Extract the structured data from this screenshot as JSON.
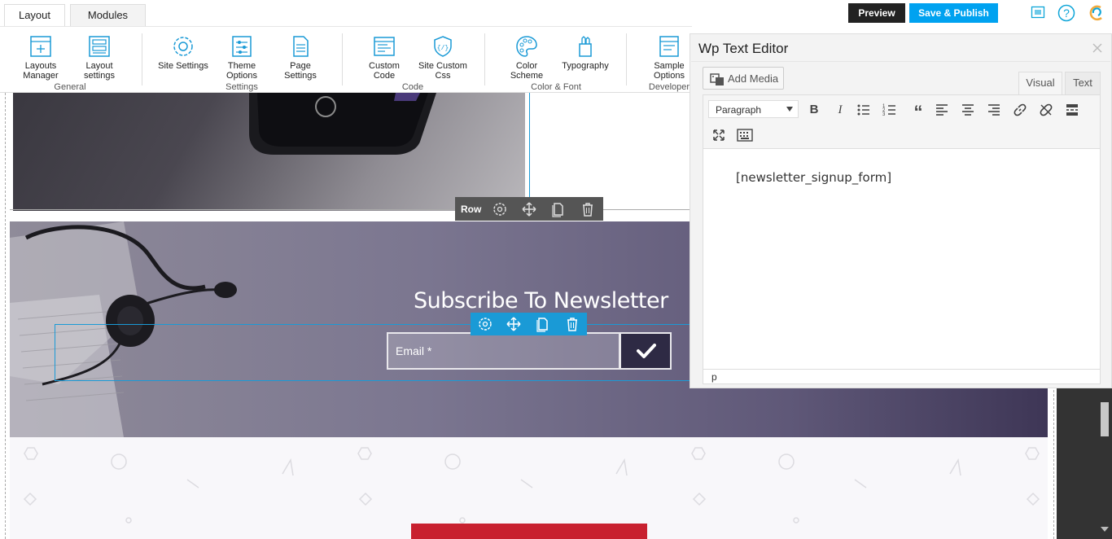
{
  "topbar": {
    "tabs": [
      {
        "label": "Layout",
        "active": true
      },
      {
        "label": "Modules",
        "active": false
      }
    ],
    "preview_label": "Preview",
    "publish_label": "Save & Publish",
    "icons": [
      "preview-frame-icon",
      "help-icon",
      "loader-logo-icon"
    ],
    "colors": {
      "preview_bg": "#222222",
      "publish_bg": "#00a2f0",
      "accent": "#0ea5d8"
    }
  },
  "ribbon": {
    "groups": [
      {
        "label": "General",
        "buttons": [
          {
            "label": "Layouts Manager",
            "icon": "layouts-manager-icon"
          },
          {
            "label": "Layout settings",
            "icon": "layout-settings-icon"
          }
        ]
      },
      {
        "label": "Settings",
        "buttons": [
          {
            "label": "Site Settings",
            "icon": "site-settings-icon"
          },
          {
            "label": "Theme Options",
            "icon": "theme-options-icon"
          },
          {
            "label": "Page Settings",
            "icon": "page-settings-icon"
          }
        ]
      },
      {
        "label": "Code",
        "buttons": [
          {
            "label": "Custom Code",
            "icon": "custom-code-icon"
          },
          {
            "label": "Site Custom Css",
            "icon": "site-css-icon"
          }
        ]
      },
      {
        "label": "Color & Font",
        "buttons": [
          {
            "label": "Color Scheme",
            "icon": "color-scheme-icon"
          },
          {
            "label": "Typography",
            "icon": "typography-icon"
          }
        ]
      },
      {
        "label": "Developer",
        "buttons": [
          {
            "label": "Sample Options",
            "icon": "sample-options-icon"
          }
        ]
      }
    ]
  },
  "canvas": {
    "row_toolbar": {
      "label": "Row",
      "icons": [
        "settings-icon",
        "move-icon",
        "duplicate-icon",
        "delete-icon"
      ]
    },
    "module_toolbar": {
      "icons": [
        "settings-icon",
        "move-icon",
        "duplicate-icon",
        "delete-icon"
      ]
    },
    "newsletter": {
      "heading": "Subscribe To Newsletter",
      "email_placeholder": "Email *",
      "submit_icon": "checkmark-icon"
    }
  },
  "editor": {
    "title": "Wp Text Editor",
    "add_media_label": "Add Media",
    "tabs": [
      {
        "label": "Visual",
        "active": true
      },
      {
        "label": "Text",
        "active": false
      }
    ],
    "format_select": "Paragraph",
    "toolbar_icons": [
      "bold-icon",
      "italic-icon",
      "bullet-list-icon",
      "numbered-list-icon",
      "blockquote-icon",
      "align-left-icon",
      "align-center-icon",
      "align-right-icon",
      "link-icon",
      "unlink-icon",
      "read-more-icon",
      "fullscreen-icon",
      "toolbar-toggle-icon"
    ],
    "content": "[newsletter_signup_form]",
    "status_path": "p"
  }
}
